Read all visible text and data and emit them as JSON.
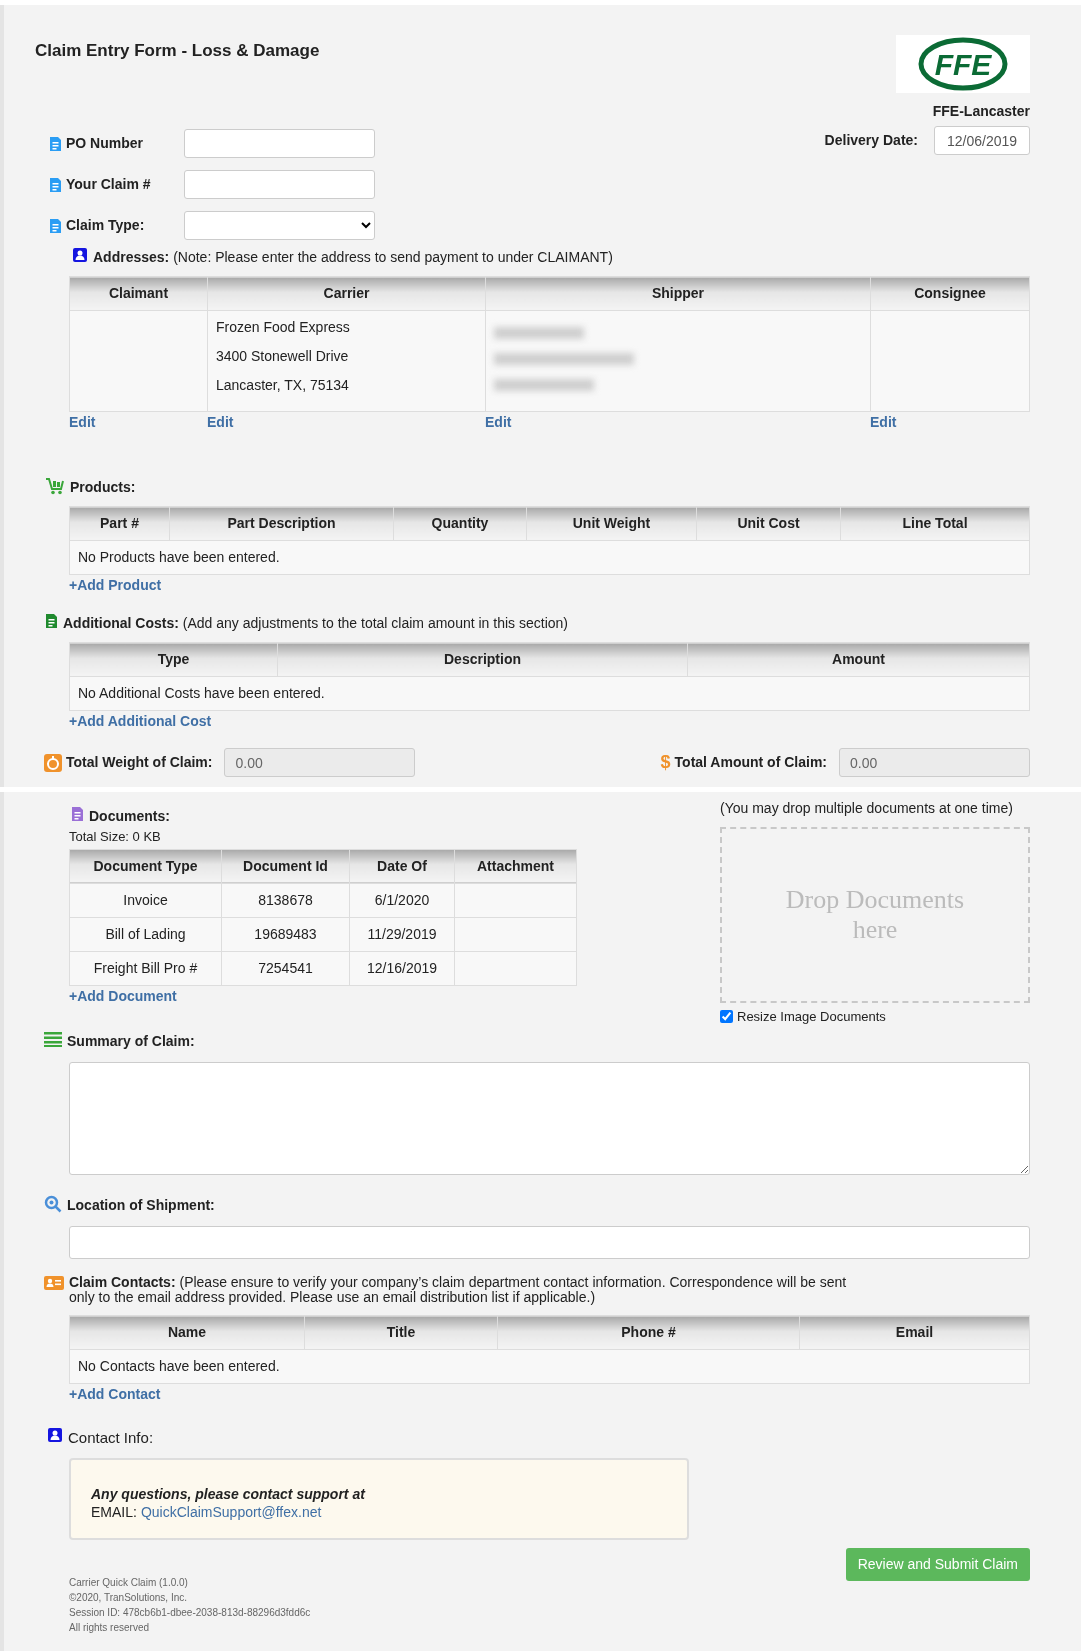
{
  "title": "Claim Entry Form - Loss & Damage",
  "logo_text": "FFE",
  "carrier_name": "FFE-Lancaster",
  "delivery_date": {
    "label": "Delivery Date:",
    "value": "12/06/2019"
  },
  "fields": [
    {
      "label": "PO Number",
      "kind": "text"
    },
    {
      "label": "Your Claim #",
      "kind": "text"
    },
    {
      "label": "Claim Type:",
      "kind": "select"
    }
  ],
  "addresses": {
    "heading": "**Addresses:** (Note: Please enter the address to send payment to under CLAIMANT)",
    "columns": [
      {
        "header": "Claimant",
        "edit": "Edit"
      },
      {
        "header": "Carrier",
        "lines": [
          "Frozen Food Express",
          "3400 Stonewell Drive",
          "Lancaster, TX, 75134"
        ],
        "edit": "Edit"
      },
      {
        "header": "Shipper",
        "redacted": true,
        "edit": "Edit"
      },
      {
        "header": "Consignee",
        "edit": "Edit"
      }
    ]
  },
  "products": {
    "heading": "**Products:**",
    "columns": [
      "Part #",
      "Part Description",
      "Quantity",
      "Unit Weight",
      "Unit Cost",
      "Line Total"
    ],
    "empty_message": "No Products have been entered.",
    "add_link": "+Add Product"
  },
  "additional_costs": {
    "heading": "**Additional Costs:** (Add any adjustments to the total claim amount in this section)",
    "columns": [
      "Type",
      "Description",
      "Amount"
    ],
    "empty_message": "No Additional Costs have been entered.",
    "add_link": "+Add Additional Cost"
  },
  "totals": [
    {
      "kind": "weight",
      "label": "Total Weight of Claim:",
      "value": "0.00"
    },
    {
      "kind": "amount",
      "icon": "$",
      "label": "Total Amount of Claim:",
      "value": "0.00"
    }
  ],
  "documents": {
    "heading": "Documents:",
    "total_size": "Total Size: 0 KB",
    "columns": [
      "Document Type",
      "Document Id",
      "Date Of",
      "Attachment"
    ],
    "rows": [
      [
        "Invoice",
        "8138678",
        "6/1/2020"
      ],
      [
        "Bill of Lading",
        "19689483",
        "11/29/2019"
      ],
      [
        "Freight Bill Pro #",
        "7254541",
        "12/16/2019"
      ]
    ],
    "add_link": "+Add Document"
  },
  "drop_zone": {
    "hint": "(You may drop multiple documents at one time)",
    "text": "Drop Documents here",
    "resize_option": {
      "label": "Resize Image Documents",
      "checked": true
    }
  },
  "summary": {
    "heading": "Summary of Claim:"
  },
  "location": {
    "heading": "Location of Shipment:"
  },
  "contacts": {
    "heading": "**Claim Contacts:** (Please ensure to verify your company’s claim department contact information. Correspondence will be sent only to the email address provided. Please use an email distribution list if applicable.)",
    "columns": [
      "Name",
      "Title",
      "Phone #",
      "Email"
    ],
    "empty_message": "No Contacts have been entered.",
    "add_link": "+Add Contact"
  },
  "contact_info": {
    "heading": "Contact Info:",
    "question": "Any questions, please contact support at",
    "email_label": "EMAIL:",
    "email": "QuickClaimSupport@ffex.net"
  },
  "submit_button": "Review and Submit Claim",
  "footer": [
    "Carrier Quick Claim (1.0.0)",
    "©2020, TranSolutions, Inc.",
    "Session ID: 478cb6b1-dbee-2038-813d-88296d3fdd6c",
    "All rights reserved"
  ]
}
